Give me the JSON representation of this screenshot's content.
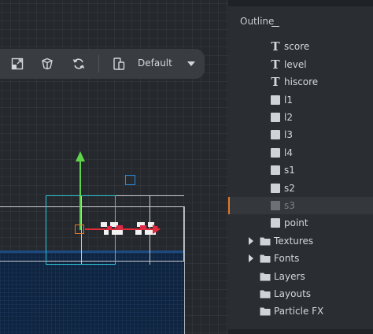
{
  "toolbar": {
    "tools": [
      {
        "name": "scale-tool",
        "icon": "scale-icon"
      },
      {
        "name": "perspective-tool",
        "icon": "cube-icon"
      },
      {
        "name": "rotate-camera-tool",
        "icon": "refresh-icon"
      }
    ],
    "layout_selector": {
      "icon": "devices-icon",
      "value": "Default"
    }
  },
  "outline": {
    "title": "Outline",
    "items": [
      {
        "label": "",
        "type": "text",
        "icon": "dash-icon"
      },
      {
        "label": "score",
        "type": "text",
        "icon": "text-icon"
      },
      {
        "label": "level",
        "type": "text",
        "icon": "text-icon"
      },
      {
        "label": "hiscore",
        "type": "text",
        "icon": "text-icon"
      },
      {
        "label": "l1",
        "type": "box",
        "icon": "box-node-icon"
      },
      {
        "label": "l2",
        "type": "box",
        "icon": "box-node-icon"
      },
      {
        "label": "l3",
        "type": "box",
        "icon": "box-node-icon"
      },
      {
        "label": "l4",
        "type": "box",
        "icon": "box-node-icon"
      },
      {
        "label": "s1",
        "type": "box",
        "icon": "box-node-icon"
      },
      {
        "label": "s2",
        "type": "box",
        "icon": "box-node-icon"
      },
      {
        "label": "s3",
        "type": "box",
        "icon": "box-node-icon",
        "selected": true
      },
      {
        "label": "point",
        "type": "box",
        "icon": "box-node-icon"
      },
      {
        "label": "Textures",
        "type": "folder",
        "icon": "folder-icon",
        "expandable": true
      },
      {
        "label": "Fonts",
        "type": "folder",
        "icon": "folder-icon",
        "expandable": true
      },
      {
        "label": "Layers",
        "type": "folder",
        "icon": "folder-icon"
      },
      {
        "label": "Layouts",
        "type": "folder",
        "icon": "folder-icon"
      },
      {
        "label": "Particle FX",
        "type": "folder",
        "icon": "folder-icon"
      }
    ]
  },
  "colors": {
    "selection": "#2ec4d6",
    "gizmo_x": "#e02b3a",
    "gizmo_y": "#5fd34a",
    "pivot": "#e07b2a",
    "plane_handle": "#2a8ce0",
    "selected_marker": "#e07b2a"
  }
}
